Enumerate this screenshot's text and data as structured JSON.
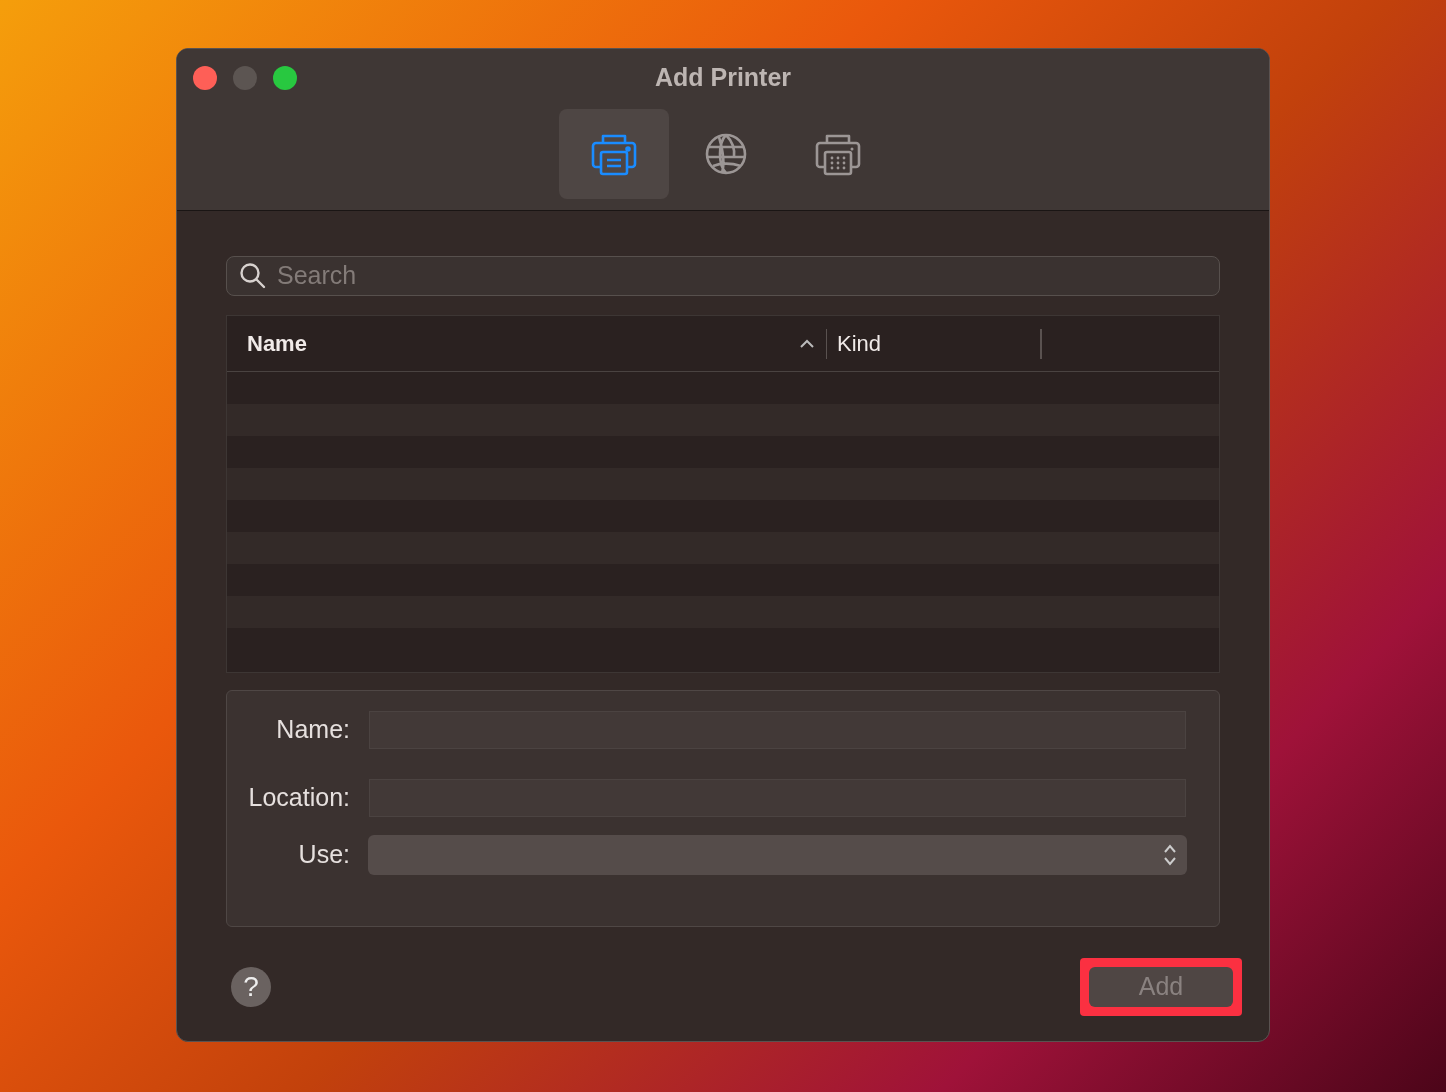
{
  "window": {
    "title": "Add Printer"
  },
  "toolbar": [
    {
      "kind": "printer",
      "selected": true
    },
    {
      "kind": "globe",
      "selected": false
    },
    {
      "kind": "fax",
      "selected": false
    }
  ],
  "search": {
    "placeholder": "Search"
  },
  "table": {
    "columns": [
      {
        "label": "Name",
        "sorted": true
      },
      {
        "label": "Kind",
        "sorted": false
      }
    ]
  },
  "form": [
    {
      "kind": "text",
      "label": "Name:"
    },
    {
      "kind": "text",
      "label": "Location:"
    },
    {
      "kind": "select",
      "label": "Use:"
    }
  ],
  "help_button": {
    "label": "?"
  },
  "add_button": {
    "label": "Add",
    "disabled": true,
    "highlighted": true
  }
}
